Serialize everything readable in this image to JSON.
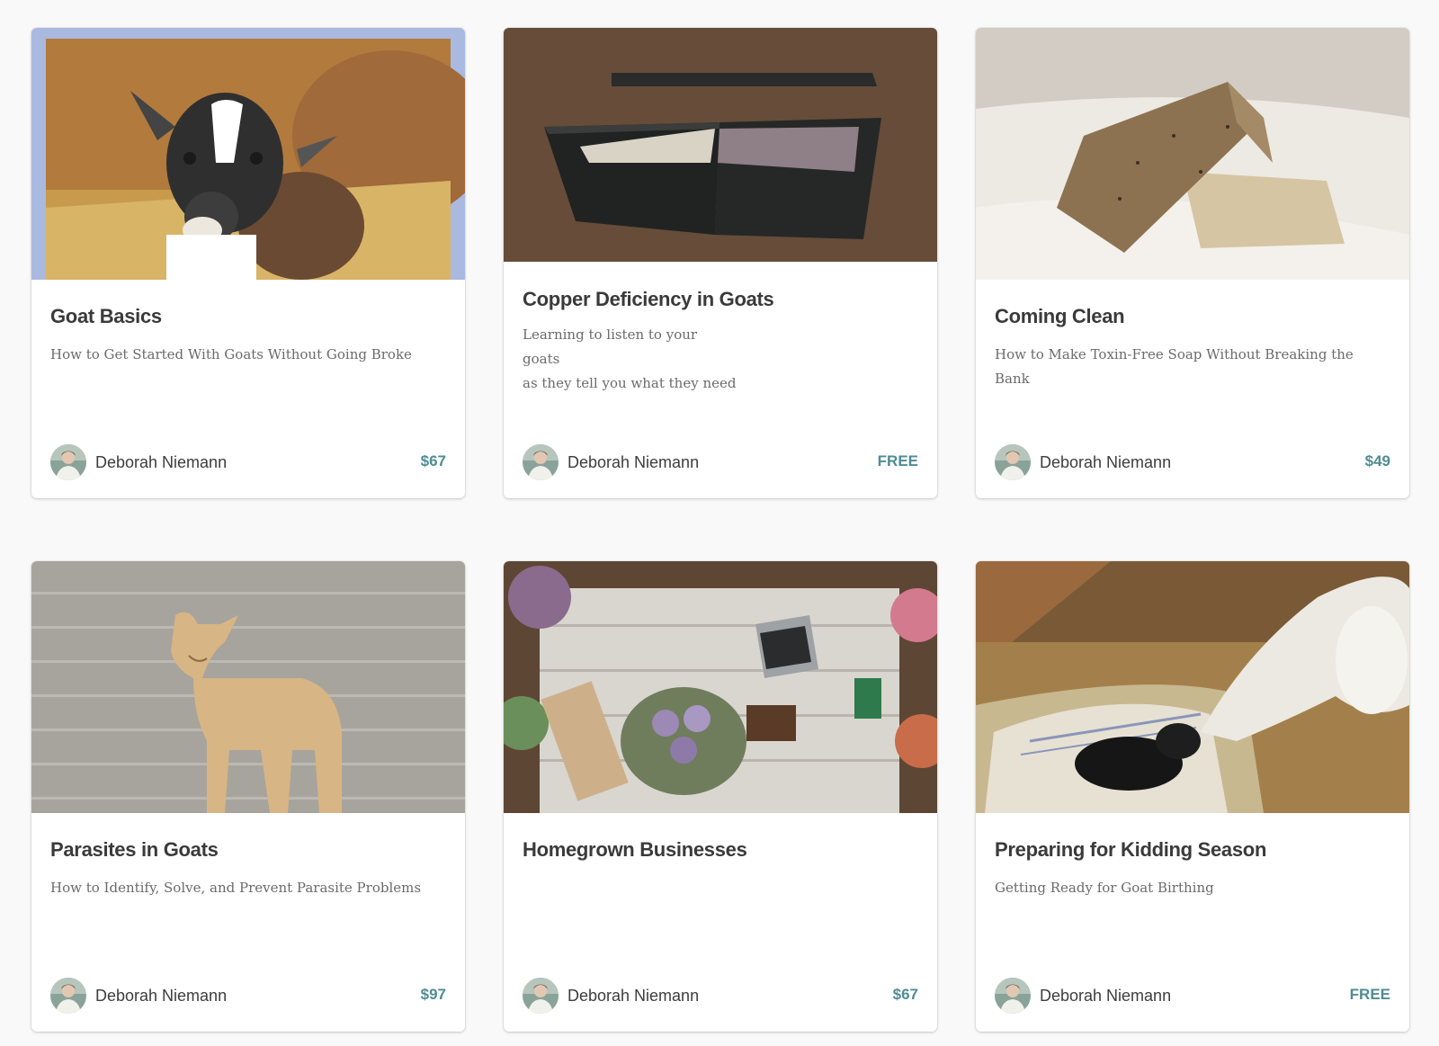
{
  "colors": {
    "price": "#4f8c93",
    "title": "#3a3a3a",
    "subtitle": "#6b6b6b",
    "background": "#f9f9f9"
  },
  "courses": [
    {
      "title": "Goat Basics",
      "subtitle": "How to Get Started With Goats Without Going Broke",
      "author": "Deborah Niemann",
      "price": "$67",
      "image": "goat-kid-in-straw-image"
    },
    {
      "title": "Copper Deficiency in Goats",
      "subtitle": "Learning to listen to your goats\nas they tell you what they need",
      "author": "Deborah Niemann",
      "price": "FREE",
      "image": "mineral-feeder-image"
    },
    {
      "title": "Coming Clean",
      "subtitle": "How to Make Toxin-Free Soap Without Breaking the Bank",
      "author": "Deborah Niemann",
      "price": "$49",
      "image": "soap-bars-image"
    },
    {
      "title": "Parasites in Goats",
      "subtitle": "How to Identify, Solve, and Prevent Parasite Problems",
      "author": "Deborah Niemann",
      "price": "$97",
      "image": "tan-goat-image"
    },
    {
      "title": "Homegrown Businesses",
      "subtitle": "",
      "author": "Deborah Niemann",
      "price": "$67",
      "image": "craft-table-flowers-laptop-image"
    },
    {
      "title": "Preparing for Kidding Season",
      "subtitle": "Getting Ready for Goat Birthing",
      "author": "Deborah Niemann",
      "price": "FREE",
      "image": "newborn-kid-with-doe-image"
    }
  ]
}
